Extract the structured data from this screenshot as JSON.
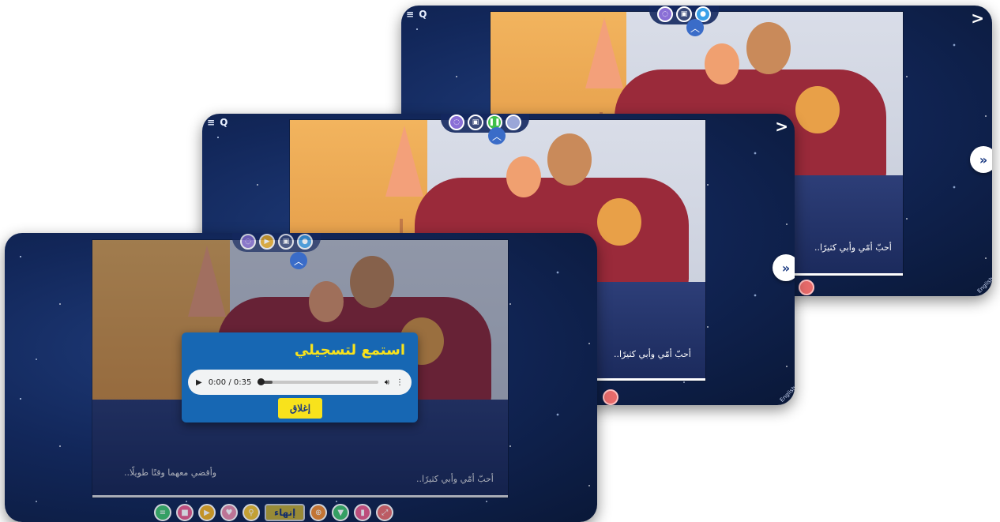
{
  "colors": {
    "panel_bg": "#12275a",
    "dialog_bg": "#1767b3",
    "title_yellow": "#f8e21c",
    "finish_yellow": "#f4d22a"
  },
  "panel_back": {
    "caption": "أحبّ أمّي وأبي كثيرًا..",
    "corner": "English",
    "top_buttons": [
      "chat-icon",
      "save-icon",
      "mic-icon"
    ]
  },
  "panel_middle": {
    "caption": "أحبّ أمّي وأبي كثيرًا..",
    "corner": "English",
    "top_buttons": [
      "chat-icon",
      "save-icon",
      "pause-icon",
      "record-icon"
    ]
  },
  "panel_front": {
    "caption_left": "وأقضي معهما وقتًا طويلًا..",
    "caption_right": "أحبّ أمّي وأبي كثيرًا..",
    "top_buttons": [
      "chat-icon",
      "play-icon",
      "save-icon",
      "mic-icon"
    ],
    "bottom_buttons": [
      "list-icon",
      "stop-icon",
      "play-icon",
      "heart-icon",
      "search-icon"
    ],
    "finish_label": "إنهاء",
    "bottom_buttons_right": [
      "zoom-icon",
      "bookmark-icon",
      "bookmark-fill-icon",
      "fullscreen-icon"
    ]
  },
  "dialog": {
    "title": "استمع لتسجيلي",
    "time": "0:00 / 0:35",
    "progress": 0.0,
    "close_label": "إغلاق"
  }
}
